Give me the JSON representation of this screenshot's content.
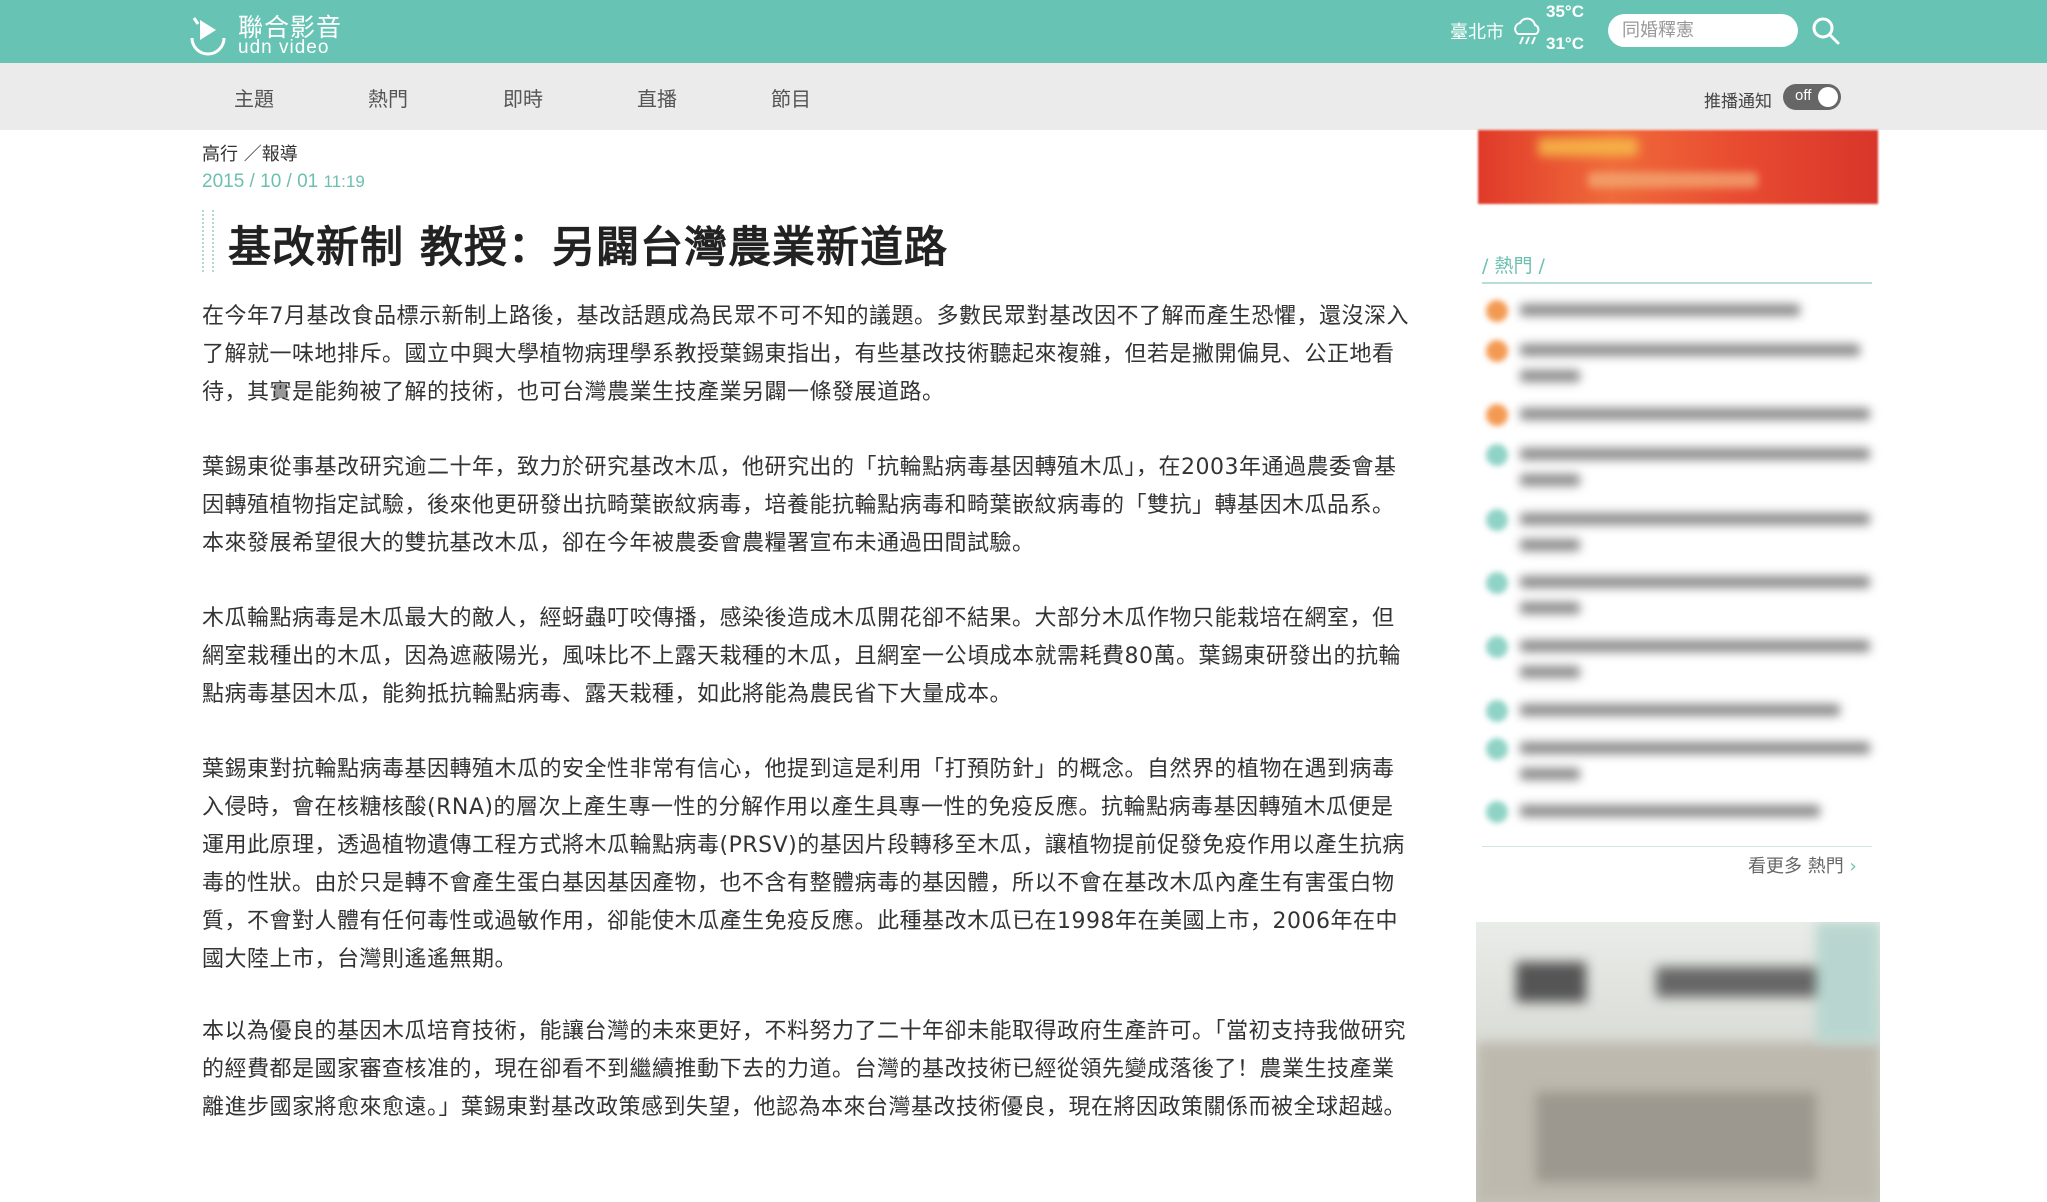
{
  "header": {
    "logo_cn": "聯合影音",
    "logo_en": "udn video",
    "city": "臺北市",
    "temp_high": "35°C",
    "temp_low": "31°C",
    "search_placeholder": "同婚釋憲"
  },
  "nav": {
    "items": [
      "主題",
      "熱門",
      "即時",
      "直播",
      "節目"
    ],
    "push_label": "推播通知",
    "push_toggle": "off"
  },
  "article": {
    "breadcrumb": "高行 ／報導",
    "date_year": "2015",
    "date_md": "10 / 01",
    "date_time": "11:19",
    "title": "基改新制 教授：另闢台灣農業新道路",
    "paragraphs": [
      "在今年7月基改食品標示新制上路後，基改話題成為民眾不可不知的議題。多數民眾對基改因不了解而產生恐懼，還沒深入了解就一味地排斥。國立中興大學植物病理學系教授葉錫東指出，有些基改技術聽起來複雜，但若是撇開偏見、公正地看待，其實是能夠被了解的技術，也可台灣農業生技產業另闢一條發展道路。",
      "葉錫東從事基改研究逾二十年，致力於研究基改木瓜，他研究出的「抗輪點病毒基因轉殖木瓜」，在2003年通過農委會基因轉殖植物指定試驗，後來他更研發出抗畸葉嵌紋病毒，培養能抗輪點病毒和畸葉嵌紋病毒的「雙抗」轉基因木瓜品系。本來發展希望很大的雙抗基改木瓜，卻在今年被農委會農糧署宣布未通過田間試驗。",
      "木瓜輪點病毒是木瓜最大的敵人，經蚜蟲叮咬傳播，感染後造成木瓜開花卻不結果。大部分木瓜作物只能栽培在網室，但網室栽種出的木瓜，因為遮蔽陽光，風味比不上露天栽種的木瓜，且網室一公頃成本就需耗費80萬。葉錫東研發出的抗輪點病毒基因木瓜，能夠抵抗輪點病毒、露天栽種，如此將能為農民省下大量成本。",
      "葉錫東對抗輪點病毒基因轉殖木瓜的安全性非常有信心，他提到這是利用「打預防針」的概念。自然界的植物在遇到病毒入侵時，會在核糖核酸(RNA)的層次上產生專一性的分解作用以產生具專一性的免疫反應。抗輪點病毒基因轉殖木瓜便是運用此原理，透過植物遺傳工程方式將木瓜輪點病毒(PRSV)的基因片段轉移至木瓜，讓植物提前促發免疫作用以產生抗病毒的性狀。由於只是轉不會產生蛋白基因基因產物，也不含有整體病毒的基因體，所以不會在基改木瓜內產生有害蛋白物質，不會對人體有任何毒性或過敏作用，卻能使木瓜產生免疫反應。此種基改木瓜已在1998年在美國上市，2006年在中國大陸上市，台灣則遙遙無期。",
      "本以為優良的基因木瓜培育技術，能讓台灣的未來更好，不料努力了二十年卻未能取得政府生產許可。「當初支持我做研究的經費都是國家審查核准的，現在卻看不到繼續推動下去的力道。台灣的基改技術已經從領先變成落後了！農業生技產業離進步國家將愈來愈遠。」葉錫東對基改政策感到失望，他認為本來台灣基改技術優良，現在將因政策關係而被全球超越。"
    ]
  },
  "sidebar": {
    "hot_heading": "/ 熱門 /",
    "more_link": "看更多 熱門",
    "rank_colors": [
      "#f39a52",
      "#f39a52",
      "#f39a52",
      "#8fd3c6",
      "#8fd3c6",
      "#8fd3c6",
      "#8fd3c6",
      "#8fd3c6",
      "#8fd3c6",
      "#8fd3c6"
    ]
  }
}
